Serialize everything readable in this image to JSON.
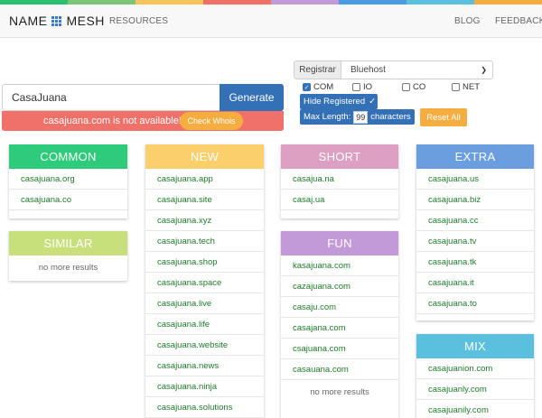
{
  "colors": {
    "strip": [
      "#2bc06f",
      "#7cc576",
      "#f8c55a",
      "#f07067",
      "#c39ad8",
      "#4b9be0",
      "#5bc0de",
      "#f6ad3f"
    ],
    "common": "#2ecb7a",
    "similar": "#c7e07c",
    "new": "#fccf6d",
    "short": "#dda0c2",
    "fun": "#c39ad8",
    "extra": "#6a9edf",
    "mix": "#5bc0de",
    "primary": "#3470b5",
    "warning": "#f6ad3f",
    "danger": "#f0706a"
  },
  "nav": {
    "logo_left": "NAME",
    "logo_right": "MESH",
    "resources": "RESOURCES",
    "blog": "BLOG",
    "feedback": "FEEDBACK"
  },
  "search": {
    "value": "CasaJuana",
    "generate": "Generate",
    "alert": "casajuana.com is not available!",
    "check_whois": "Check Whois"
  },
  "registrar": {
    "label": "Registrar",
    "selected": "Bluehost"
  },
  "tlds": [
    {
      "label": "COM",
      "checked": true
    },
    {
      "label": "IO",
      "checked": false
    },
    {
      "label": "CO",
      "checked": false
    },
    {
      "label": "NET",
      "checked": false
    }
  ],
  "filters": {
    "hide_registered": "Hide Registered",
    "check_mark": "✓",
    "max_length_label": "Max Length:",
    "max_length_value": "99",
    "characters": "characters",
    "reset_all": "Reset All"
  },
  "sections": {
    "common": {
      "title": "COMMON",
      "items": [
        "casajuana.org",
        "casajuana.co"
      ]
    },
    "similar": {
      "title": "SIMILAR",
      "empty": "no more results"
    },
    "new": {
      "title": "NEW",
      "items": [
        "casajuana.app",
        "casajuana.site",
        "casajuana.xyz",
        "casajuana.tech",
        "casajuana.shop",
        "casajuana.space",
        "casajuana.live",
        "casajuana.life",
        "casajuana.website",
        "casajuana.news",
        "casajuana.ninja",
        "casajuana.solutions"
      ]
    },
    "short": {
      "title": "SHORT",
      "items": [
        "casajua.na",
        "casaj.ua"
      ]
    },
    "fun": {
      "title": "FUN",
      "items": [
        "kasajuana.com",
        "cazajuana.com",
        "casaju.com",
        "casajana.com",
        "csajuana.com",
        "casauana.com"
      ],
      "empty": "no more results"
    },
    "extra": {
      "title": "EXTRA",
      "items": [
        "casajuana.us",
        "casajuana.biz",
        "casajuana.cc",
        "casajuana.tv",
        "casajuana.tk",
        "casajuana.it",
        "casajuana.to"
      ]
    },
    "mix": {
      "title": "MIX",
      "items": [
        "casajuanion.com",
        "casajuanly.com",
        "casajuanily.com"
      ]
    }
  }
}
